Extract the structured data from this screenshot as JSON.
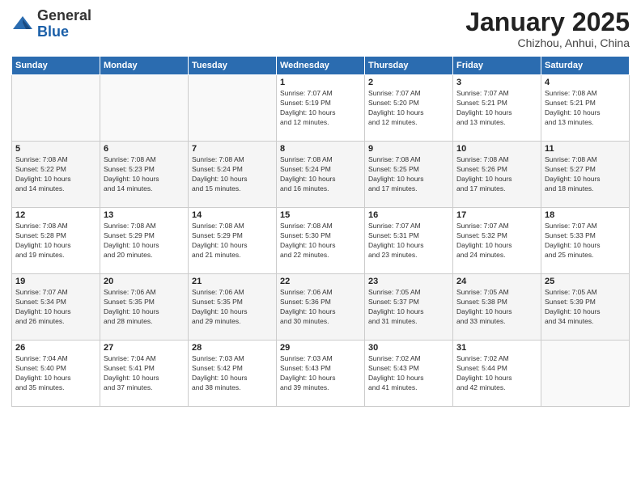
{
  "logo": {
    "general": "General",
    "blue": "Blue"
  },
  "header": {
    "month": "January 2025",
    "location": "Chizhou, Anhui, China"
  },
  "weekdays": [
    "Sunday",
    "Monday",
    "Tuesday",
    "Wednesday",
    "Thursday",
    "Friday",
    "Saturday"
  ],
  "weeks": [
    [
      {
        "day": "",
        "info": ""
      },
      {
        "day": "",
        "info": ""
      },
      {
        "day": "",
        "info": ""
      },
      {
        "day": "1",
        "info": "Sunrise: 7:07 AM\nSunset: 5:19 PM\nDaylight: 10 hours\nand 12 minutes."
      },
      {
        "day": "2",
        "info": "Sunrise: 7:07 AM\nSunset: 5:20 PM\nDaylight: 10 hours\nand 12 minutes."
      },
      {
        "day": "3",
        "info": "Sunrise: 7:07 AM\nSunset: 5:21 PM\nDaylight: 10 hours\nand 13 minutes."
      },
      {
        "day": "4",
        "info": "Sunrise: 7:08 AM\nSunset: 5:21 PM\nDaylight: 10 hours\nand 13 minutes."
      }
    ],
    [
      {
        "day": "5",
        "info": "Sunrise: 7:08 AM\nSunset: 5:22 PM\nDaylight: 10 hours\nand 14 minutes."
      },
      {
        "day": "6",
        "info": "Sunrise: 7:08 AM\nSunset: 5:23 PM\nDaylight: 10 hours\nand 14 minutes."
      },
      {
        "day": "7",
        "info": "Sunrise: 7:08 AM\nSunset: 5:24 PM\nDaylight: 10 hours\nand 15 minutes."
      },
      {
        "day": "8",
        "info": "Sunrise: 7:08 AM\nSunset: 5:24 PM\nDaylight: 10 hours\nand 16 minutes."
      },
      {
        "day": "9",
        "info": "Sunrise: 7:08 AM\nSunset: 5:25 PM\nDaylight: 10 hours\nand 17 minutes."
      },
      {
        "day": "10",
        "info": "Sunrise: 7:08 AM\nSunset: 5:26 PM\nDaylight: 10 hours\nand 17 minutes."
      },
      {
        "day": "11",
        "info": "Sunrise: 7:08 AM\nSunset: 5:27 PM\nDaylight: 10 hours\nand 18 minutes."
      }
    ],
    [
      {
        "day": "12",
        "info": "Sunrise: 7:08 AM\nSunset: 5:28 PM\nDaylight: 10 hours\nand 19 minutes."
      },
      {
        "day": "13",
        "info": "Sunrise: 7:08 AM\nSunset: 5:29 PM\nDaylight: 10 hours\nand 20 minutes."
      },
      {
        "day": "14",
        "info": "Sunrise: 7:08 AM\nSunset: 5:29 PM\nDaylight: 10 hours\nand 21 minutes."
      },
      {
        "day": "15",
        "info": "Sunrise: 7:08 AM\nSunset: 5:30 PM\nDaylight: 10 hours\nand 22 minutes."
      },
      {
        "day": "16",
        "info": "Sunrise: 7:07 AM\nSunset: 5:31 PM\nDaylight: 10 hours\nand 23 minutes."
      },
      {
        "day": "17",
        "info": "Sunrise: 7:07 AM\nSunset: 5:32 PM\nDaylight: 10 hours\nand 24 minutes."
      },
      {
        "day": "18",
        "info": "Sunrise: 7:07 AM\nSunset: 5:33 PM\nDaylight: 10 hours\nand 25 minutes."
      }
    ],
    [
      {
        "day": "19",
        "info": "Sunrise: 7:07 AM\nSunset: 5:34 PM\nDaylight: 10 hours\nand 26 minutes."
      },
      {
        "day": "20",
        "info": "Sunrise: 7:06 AM\nSunset: 5:35 PM\nDaylight: 10 hours\nand 28 minutes."
      },
      {
        "day": "21",
        "info": "Sunrise: 7:06 AM\nSunset: 5:35 PM\nDaylight: 10 hours\nand 29 minutes."
      },
      {
        "day": "22",
        "info": "Sunrise: 7:06 AM\nSunset: 5:36 PM\nDaylight: 10 hours\nand 30 minutes."
      },
      {
        "day": "23",
        "info": "Sunrise: 7:05 AM\nSunset: 5:37 PM\nDaylight: 10 hours\nand 31 minutes."
      },
      {
        "day": "24",
        "info": "Sunrise: 7:05 AM\nSunset: 5:38 PM\nDaylight: 10 hours\nand 33 minutes."
      },
      {
        "day": "25",
        "info": "Sunrise: 7:05 AM\nSunset: 5:39 PM\nDaylight: 10 hours\nand 34 minutes."
      }
    ],
    [
      {
        "day": "26",
        "info": "Sunrise: 7:04 AM\nSunset: 5:40 PM\nDaylight: 10 hours\nand 35 minutes."
      },
      {
        "day": "27",
        "info": "Sunrise: 7:04 AM\nSunset: 5:41 PM\nDaylight: 10 hours\nand 37 minutes."
      },
      {
        "day": "28",
        "info": "Sunrise: 7:03 AM\nSunset: 5:42 PM\nDaylight: 10 hours\nand 38 minutes."
      },
      {
        "day": "29",
        "info": "Sunrise: 7:03 AM\nSunset: 5:43 PM\nDaylight: 10 hours\nand 39 minutes."
      },
      {
        "day": "30",
        "info": "Sunrise: 7:02 AM\nSunset: 5:43 PM\nDaylight: 10 hours\nand 41 minutes."
      },
      {
        "day": "31",
        "info": "Sunrise: 7:02 AM\nSunset: 5:44 PM\nDaylight: 10 hours\nand 42 minutes."
      },
      {
        "day": "",
        "info": ""
      }
    ]
  ]
}
